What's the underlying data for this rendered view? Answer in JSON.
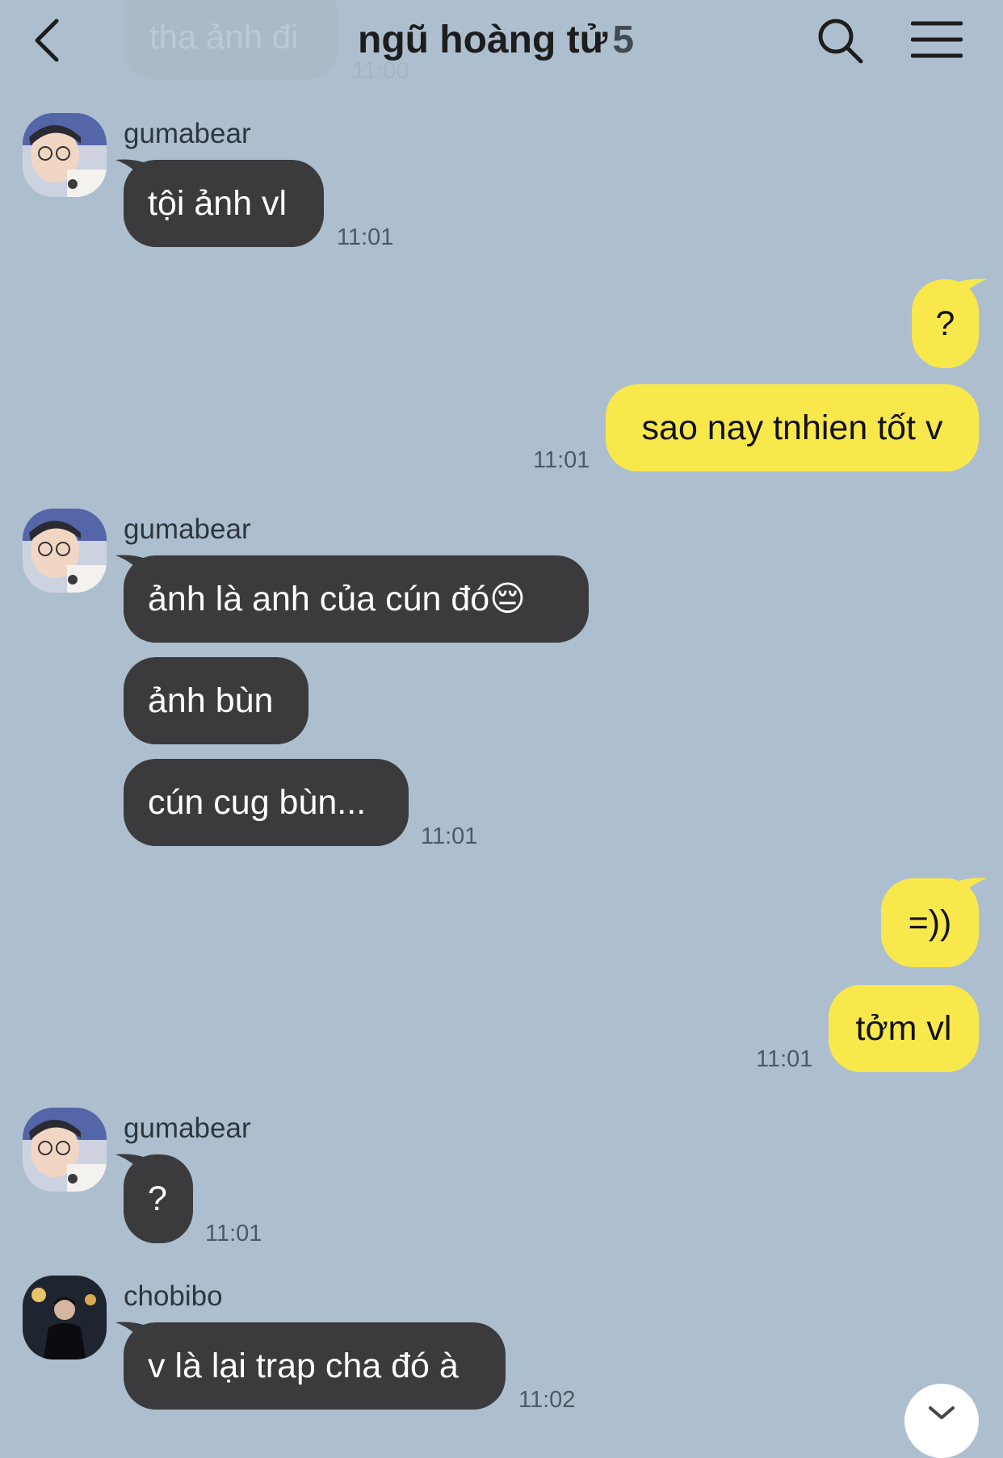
{
  "header": {
    "title": "ngũ hoàng tử",
    "member_count": "5",
    "back_icon": "chevron-left-icon",
    "search_icon": "search-icon",
    "menu_icon": "hamburger-menu-icon"
  },
  "previous": {
    "text": "tha ảnh đi",
    "time": "11:00"
  },
  "messages": [
    {
      "sender": "gumabear",
      "side": "left",
      "text": "tội ảnh vl",
      "time": "11:01"
    },
    {
      "side": "right",
      "text": "?"
    },
    {
      "side": "right",
      "text": "sao nay tnhien tốt v",
      "time": "11:01"
    },
    {
      "sender": "gumabear",
      "side": "left",
      "text": "ảnh là anh của cún đó😔"
    },
    {
      "side": "left",
      "text": "ảnh bùn"
    },
    {
      "side": "left",
      "text": "cún cug bùn...",
      "time": "11:01"
    },
    {
      "side": "right",
      "text": "=))"
    },
    {
      "side": "right",
      "text": "tởm vl",
      "time": "11:01"
    },
    {
      "sender": "gumabear",
      "side": "left",
      "text": "?",
      "time": "11:01"
    },
    {
      "sender": "chobibo",
      "side": "left",
      "text": "v là lại trap cha đó à",
      "time": "11:02"
    }
  ],
  "colors": {
    "background": "#adbfcf",
    "incoming": "#3b3b3d",
    "outgoing": "#f9e84b"
  }
}
